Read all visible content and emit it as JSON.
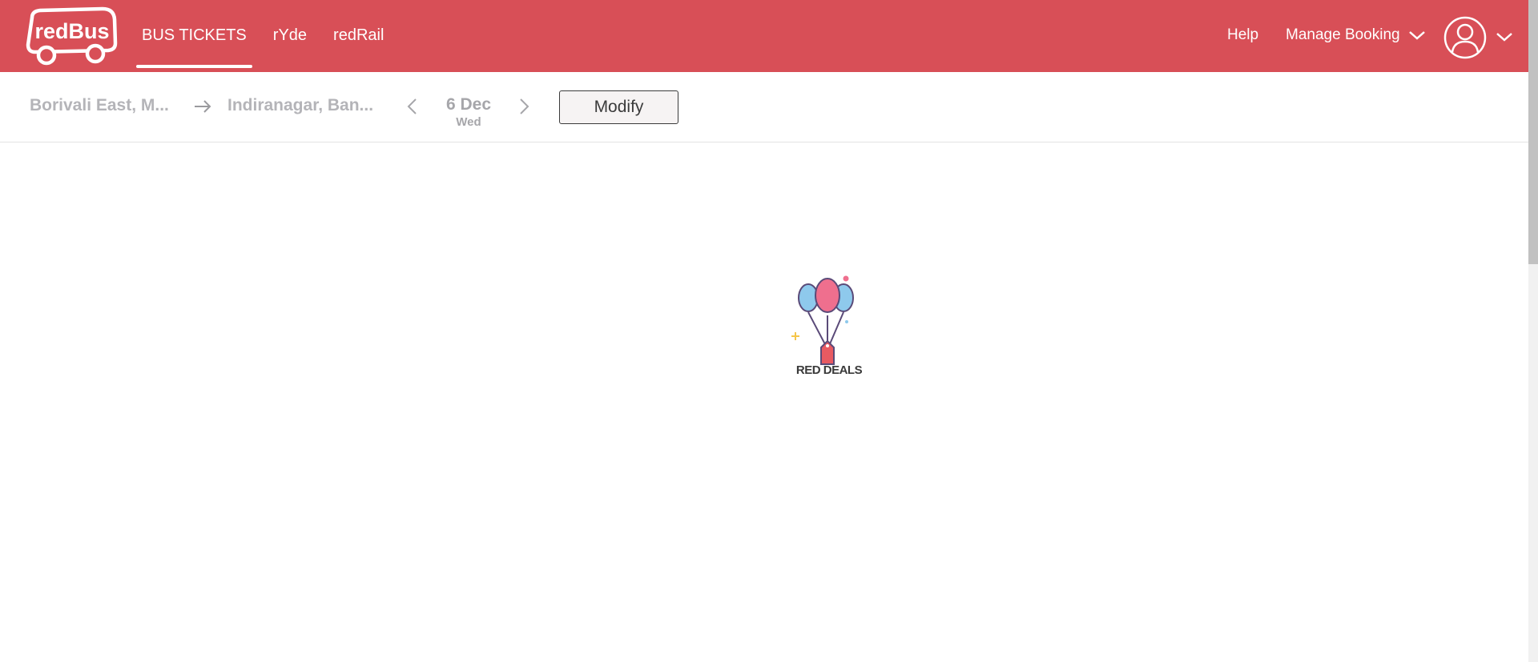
{
  "header": {
    "logo_text": "redBus",
    "nav": [
      {
        "label": "BUS TICKETS",
        "active": true
      },
      {
        "label": "rYde",
        "active": false
      },
      {
        "label": "redRail",
        "active": false
      }
    ],
    "help_label": "Help",
    "manage_booking_label": "Manage Booking",
    "icons": {
      "profile": "user-icon",
      "dropdown": "chevron-down-icon"
    }
  },
  "search": {
    "source": "Borivali East, M...",
    "destination": "Indiranagar, Ban...",
    "date": "6 Dec",
    "day": "Wed",
    "modify_label": "Modify",
    "icons": {
      "arrow": "arrow-right-icon",
      "prev": "chevron-left-icon",
      "next": "chevron-right-icon"
    }
  },
  "loader": {
    "text": "RED DEALS",
    "icon": "balloons-icon"
  },
  "colors": {
    "brand": "#d84f57",
    "muted_text": "#b4b4b8",
    "balloon_pink": "#ef6f8e",
    "balloon_blue": "#8ec9ec"
  }
}
